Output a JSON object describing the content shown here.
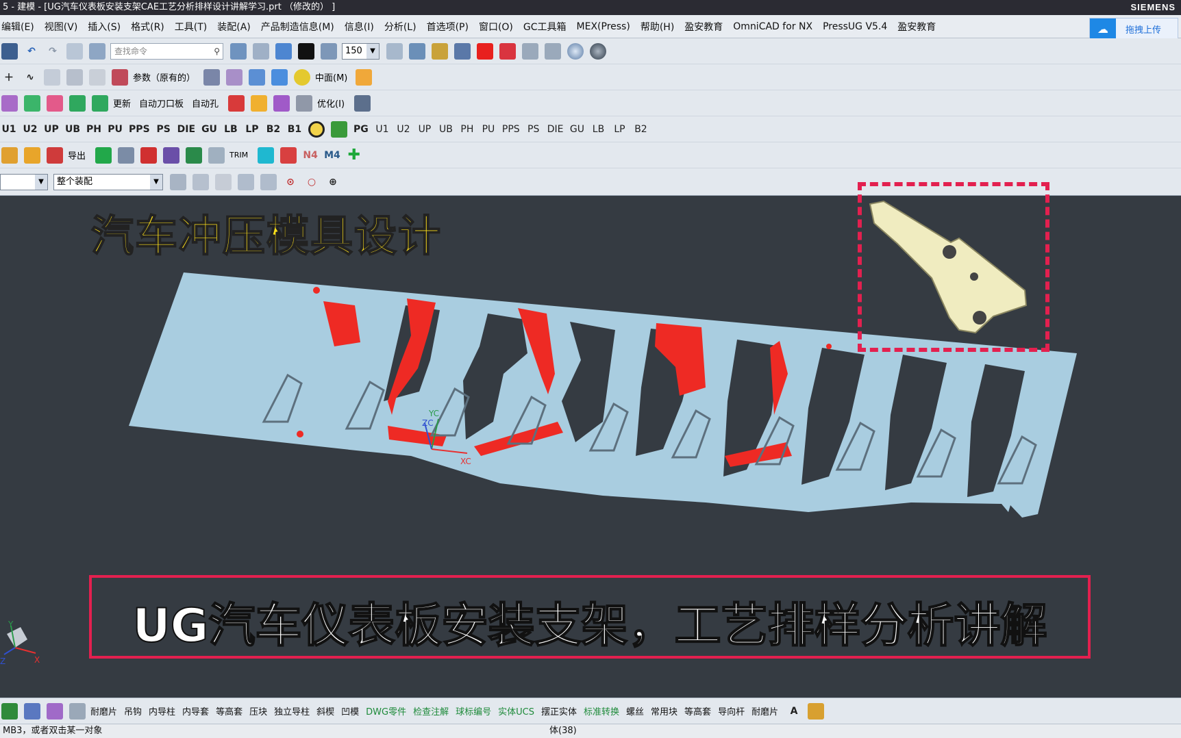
{
  "window": {
    "title": "5 - 建模 - [UG汽车仪表板安装支架CAE工艺分析排样设计讲解学习.prt （修改的） ]",
    "brand": "SIEMENS"
  },
  "menubar": {
    "items": [
      "编辑(E)",
      "视图(V)",
      "插入(S)",
      "格式(R)",
      "工具(T)",
      "装配(A)",
      "产品制造信息(M)",
      "信息(I)",
      "分析(L)",
      "首选项(P)",
      "窗口(O)",
      "GC工具箱",
      "MEX(Press)",
      "帮助(H)",
      "盈安教育",
      "OmniCAD for NX",
      "PressUG V5.4",
      "盈安教育"
    ],
    "upload": "拖拽上传"
  },
  "toolbar": {
    "search_placeholder": "查找命令",
    "zoom_value": "150",
    "row2_texts": [
      "参数（原有的）",
      "中面(M)"
    ],
    "row3_texts": [
      "更新",
      "自动刀口板",
      "自动孔",
      "优化(I)"
    ],
    "row4_texts": [
      "U1",
      "U2",
      "UP",
      "UB",
      "PH",
      "PU",
      "PPS",
      "PS",
      "DIE",
      "GU",
      "LB",
      "LP",
      "B2",
      "B1",
      "PG",
      "U1",
      "U2",
      "UP",
      "UB",
      "PH",
      "PU",
      "PPS",
      "PS",
      "DIE",
      "GU",
      "LB",
      "LP",
      "B2"
    ],
    "row5_texts": [
      "导出",
      "TRIM",
      "N4",
      "M4"
    ],
    "assembly_combo": "整个装配"
  },
  "viewport": {
    "title": "汽车冲压模具设计",
    "caption": "UG汽车仪表板安装支架，工艺排样分析讲解",
    "axis_labels": [
      "XC",
      "YC",
      "ZC",
      "X",
      "Y",
      "Z"
    ]
  },
  "bottombar": {
    "items": [
      "耐磨片",
      "吊钩",
      "内导柱",
      "内导套",
      "等高套",
      "压块",
      "独立导柱",
      "斜楔",
      "凹模",
      "DWG零件",
      "检查注解",
      "球标编号",
      "实体UCS",
      "摆正实体",
      "标准转换",
      "螺丝",
      "常用块",
      "等高套",
      "导向杆",
      "耐磨片"
    ]
  },
  "status": {
    "left": "MB3，或者双击某一对象",
    "right": "体(38)"
  },
  "colors": {
    "accent_red": "#e3204f",
    "title_yellow": "#ffe11a",
    "strip_blue": "#a9cde0",
    "feature_red": "#ee2a24"
  }
}
